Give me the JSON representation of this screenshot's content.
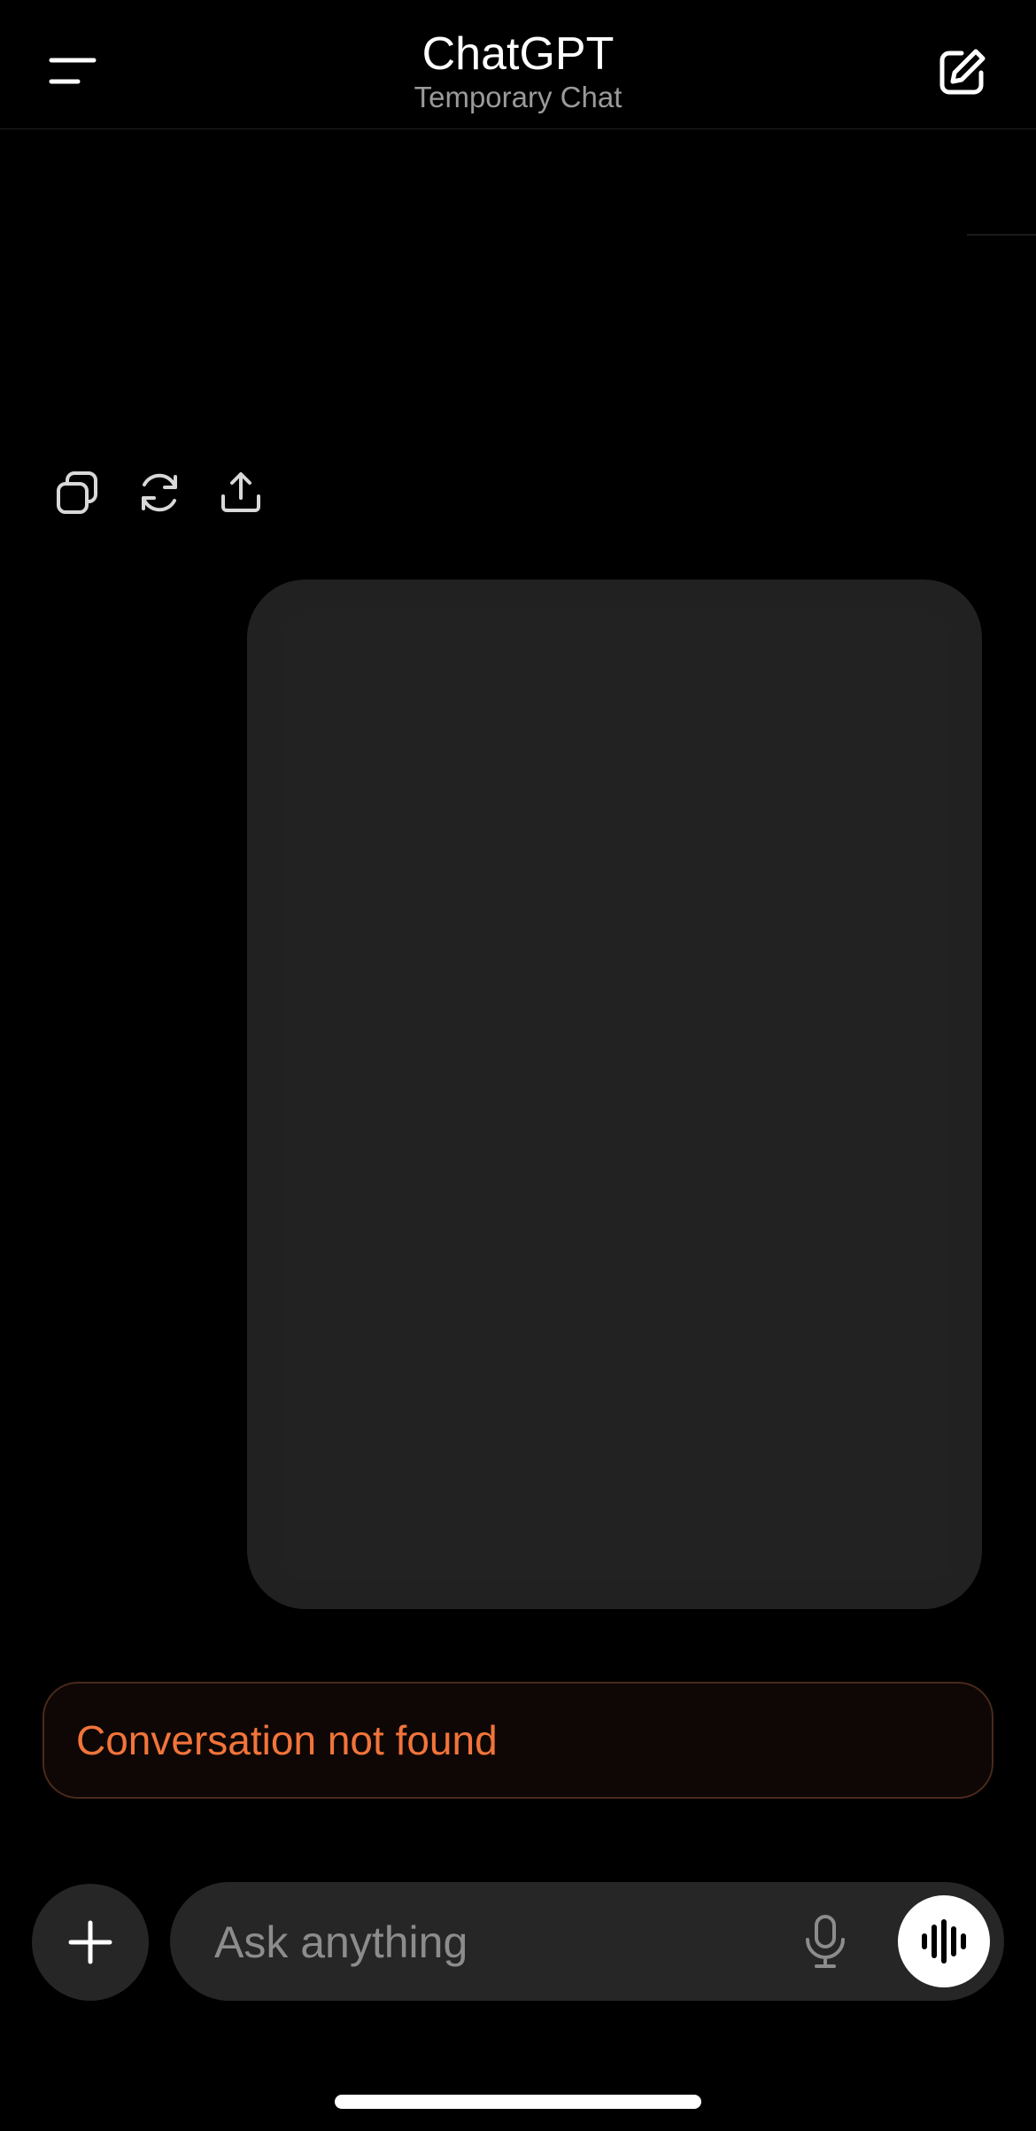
{
  "header": {
    "title": "ChatGPT",
    "subtitle": "Temporary Chat",
    "menu_icon": "menu-icon",
    "new_chat_icon": "new-chat-icon"
  },
  "message_actions": {
    "copy_icon": "copy-icon",
    "regenerate_icon": "regenerate-icon",
    "share_icon": "share-icon"
  },
  "error": {
    "text": "Conversation not found",
    "color": "#f2743a"
  },
  "composer": {
    "placeholder": "Ask anything",
    "plus_icon": "plus-icon",
    "mic_icon": "microphone-icon",
    "voice_icon": "voice-mode-icon"
  },
  "colors": {
    "background": "#000000",
    "bubble": "#212121",
    "composer": "#262626",
    "muted_text": "#9a9a9a"
  }
}
